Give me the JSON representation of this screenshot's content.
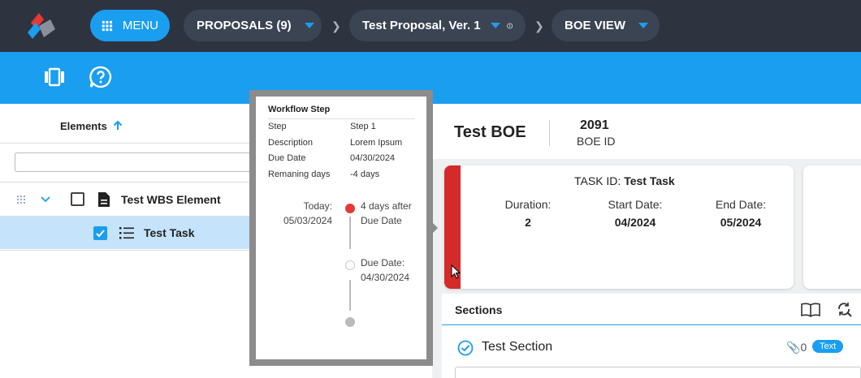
{
  "nav": {
    "menu_label": "MENU",
    "proposals_label": "PROPOSALS (9)",
    "proposal_label": "Test Proposal, Ver. 1",
    "view_label": "BOE VIEW"
  },
  "left": {
    "elements_header": "Elements",
    "filter_placeholder": "",
    "rows": [
      {
        "label": "Test WBS Element",
        "checked": false
      },
      {
        "label": "Test Task",
        "checked": true
      }
    ]
  },
  "boe": {
    "title": "Test BOE",
    "id_value": "2091",
    "id_label": "BOE ID"
  },
  "task": {
    "id_prefix": "TASK ID: ",
    "id_value": "Test Task",
    "duration_label": "Duration:",
    "duration_value": "2",
    "start_label": "Start Date:",
    "start_value": "04/2024",
    "end_label": "End Date:",
    "end_value": "05/2024",
    "status_color": "#d42a2a"
  },
  "sections": {
    "header": "Sections",
    "items": [
      {
        "title": "Test Section",
        "attachments": "0",
        "badge": "Text"
      }
    ]
  },
  "popup": {
    "title": "Workflow Step",
    "fields": [
      {
        "key": "Step",
        "value": "Step 1"
      },
      {
        "key": "Description",
        "value": "Lorem Ipsum"
      },
      {
        "key": "Due Date",
        "value": "04/30/2024"
      },
      {
        "key": "Remaning days",
        "value": "-4 days"
      }
    ],
    "today_label": "Today:",
    "today_date": "05/03/2024",
    "today_note_1": "4 days after",
    "today_note_2": "Due Date",
    "due_label": "Due Date:",
    "due_date": "04/30/2024"
  },
  "colors": {
    "accent": "#1a9ef0",
    "nav_bg": "#2d3440",
    "overdue": "#e53935"
  }
}
